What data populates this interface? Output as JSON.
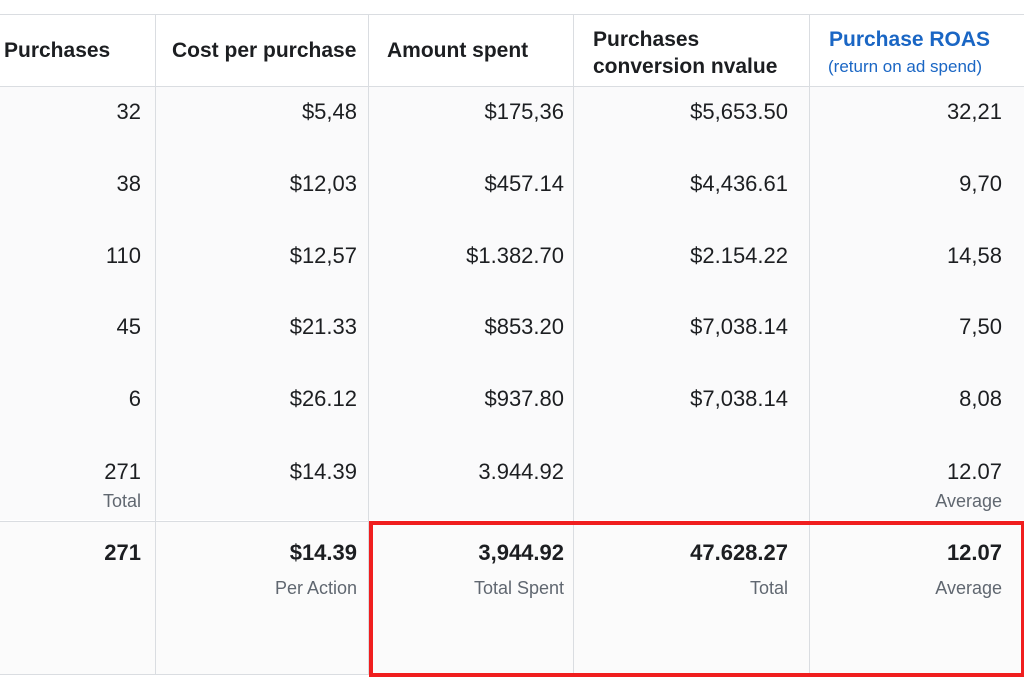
{
  "headers": {
    "purchases": "Purchases",
    "cost_per_purchase": "Cost per purchase",
    "amount_spent": "Amount spent",
    "conversion_line1": "Purchases",
    "conversion_line2": "conversion nvalue",
    "roas_title": "Purchase ROAS",
    "roas_subtitle": "(return on ad spend)"
  },
  "rows": [
    {
      "purchases": "32",
      "cost": "$5,48",
      "spent": "$175,36",
      "conv": "$5,653.50",
      "roas": "32,21"
    },
    {
      "purchases": "38",
      "cost": "$12,03",
      "spent": "$457.14",
      "conv": "$4,436.61",
      "roas": "9,70"
    },
    {
      "purchases": "110",
      "cost": "$12,57",
      "spent": "$1.382.70",
      "conv": "$2.154.22",
      "roas": "14,58"
    },
    {
      "purchases": "45",
      "cost": "$21.33",
      "spent": "$853.20",
      "conv": "$7,038.14",
      "roas": "7,50"
    },
    {
      "purchases": "6",
      "cost": "$26.12",
      "spent": "$937.80",
      "conv": "$7,038.14",
      "roas": "8,08"
    }
  ],
  "summary_row": {
    "purchases": "271",
    "purchases_label": "Total",
    "cost": "$14.39",
    "spent": "3.944.92",
    "roas": "12.07",
    "roas_label": "Average"
  },
  "totals": {
    "purchases": "271",
    "cost": "$14.39",
    "cost_label": "Per Action",
    "spent": "3,944.92",
    "spent_label": "Total Spent",
    "conv": "47.628.27",
    "conv_label": "Total",
    "roas": "12.07",
    "roas_label": "Average"
  },
  "colors": {
    "link_blue": "#1a66c4",
    "highlight_red": "#f01e1e"
  }
}
